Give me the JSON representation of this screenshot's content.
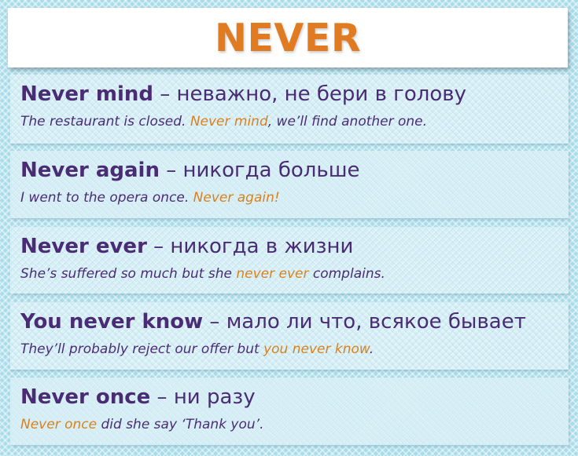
{
  "title": "NEVER",
  "colors": {
    "title": "#e07b22",
    "phrase": "#4a2c74",
    "highlight": "#d9811f",
    "background": "#a9dcea"
  },
  "entries": [
    {
      "phrase": "Never mind",
      "dash": " – ",
      "meaning": "неважно, не бери в голову",
      "example": {
        "before": "The restaurant is closed. ",
        "highlight": "Never mind",
        "after": ", we’ll find another one."
      }
    },
    {
      "phrase": "Never again",
      "dash": " – ",
      "meaning": "никогда больше",
      "example": {
        "before": "I went to the opera once. ",
        "highlight": "Never again!",
        "after": ""
      }
    },
    {
      "phrase": "Never ever",
      "dash": " – ",
      "meaning": "никогда в жизни",
      "example": {
        "before": "She’s suffered so much but she ",
        "highlight": "never ever",
        "after": " complains."
      }
    },
    {
      "phrase": "You never know",
      "dash": " – ",
      "meaning": "мало ли что, всякое бывает",
      "example": {
        "before": "They’ll probably reject our offer but ",
        "highlight": "you never know",
        "after": "."
      }
    },
    {
      "phrase": "Never once",
      "dash": " – ",
      "meaning": "ни разу",
      "example": {
        "before": "",
        "highlight": "Never once",
        "after": " did she say ‘Thank you’."
      }
    }
  ]
}
